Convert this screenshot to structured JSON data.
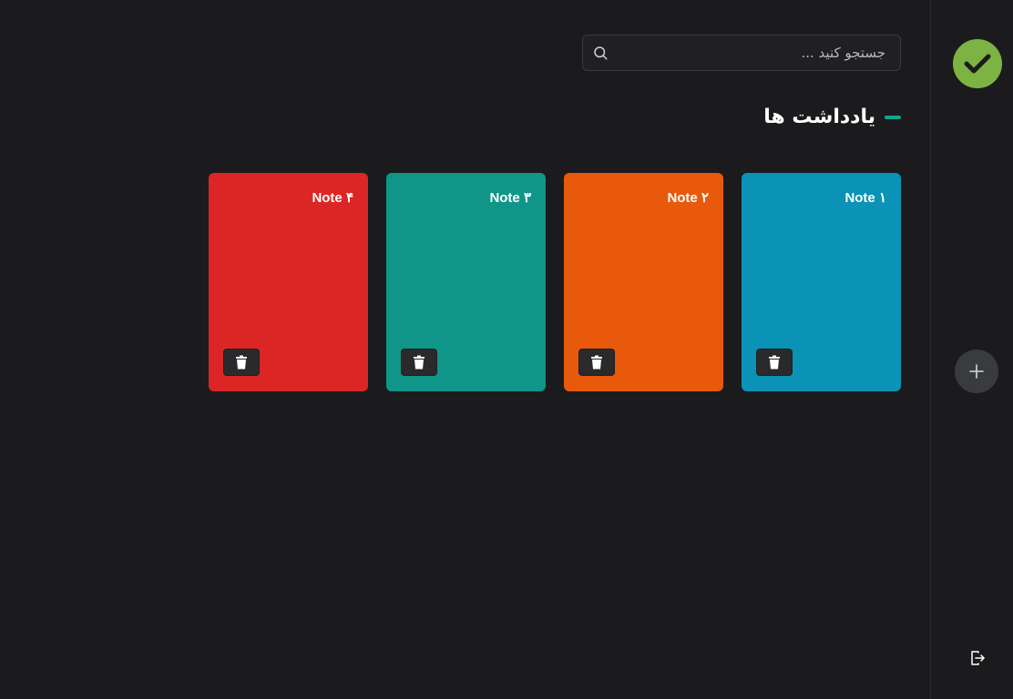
{
  "search": {
    "placeholder": "جستجو کنید ...",
    "value": ""
  },
  "main": {
    "title": "یادداشت ها"
  },
  "notes": [
    {
      "title": "Note ۱",
      "color": "#0a93b6"
    },
    {
      "title": "Note ۲",
      "color": "#e8590c"
    },
    {
      "title": "Note ۳",
      "color": "#0f9689"
    },
    {
      "title": "Note ۴",
      "color": "#dc2626"
    }
  ],
  "sidebar": {
    "logo_icon": "check-circle-icon",
    "add_icon": "plus-icon",
    "logout_icon": "logout-icon",
    "logo_color": "#7cb342"
  },
  "theme": {
    "background": "#1b1b1d",
    "accent": "#12a58d"
  }
}
